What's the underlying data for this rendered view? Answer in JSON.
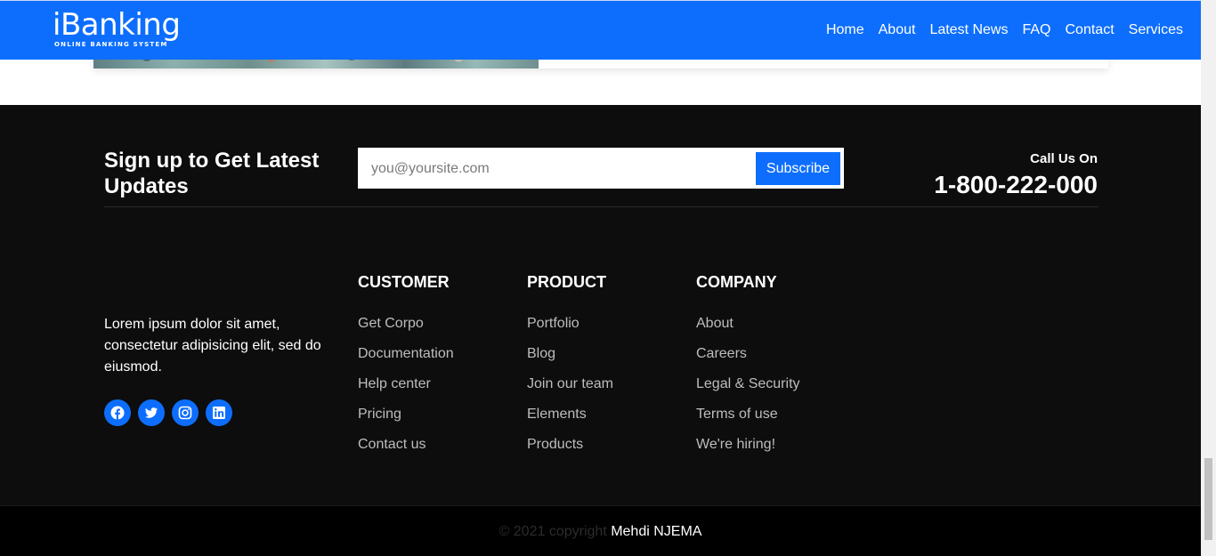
{
  "brand": {
    "name": "iBanking",
    "tagline": "ONLINE BANKING SYSTEM"
  },
  "nav": [
    "Home",
    "About",
    "Latest News",
    "FAQ",
    "Contact",
    "Services"
  ],
  "signup": {
    "title": "Sign up to Get Latest Updates",
    "email_placeholder": "you@yoursite.com",
    "button_label": "Subscribe"
  },
  "call": {
    "label": "Call Us On",
    "number": "1-800-222-000"
  },
  "about": {
    "text": "Lorem ipsum dolor sit amet, consectetur adipisicing elit, sed do eiusmod."
  },
  "socials": [
    "facebook-icon",
    "twitter-icon",
    "instagram-icon",
    "linkedin-icon"
  ],
  "columns": {
    "customer": {
      "title": "CUSTOMER",
      "links": [
        "Get Corpo",
        "Documentation",
        "Help center",
        "Pricing",
        "Contact us"
      ]
    },
    "product": {
      "title": "PRODUCT",
      "links": [
        "Portfolio",
        "Blog",
        "Join our team",
        "Elements",
        "Products"
      ]
    },
    "company": {
      "title": "COMPANY",
      "links": [
        "About",
        "Careers",
        "Legal & Security",
        "Terms of use",
        "We're hiring!"
      ]
    }
  },
  "copyright": {
    "text": "© 2021 copyright",
    "author": "Mehdi NJEMA"
  },
  "colors": {
    "primary": "#0d6efd",
    "footer_bg": "#0d0d0d",
    "bottom_bg": "#000000"
  }
}
